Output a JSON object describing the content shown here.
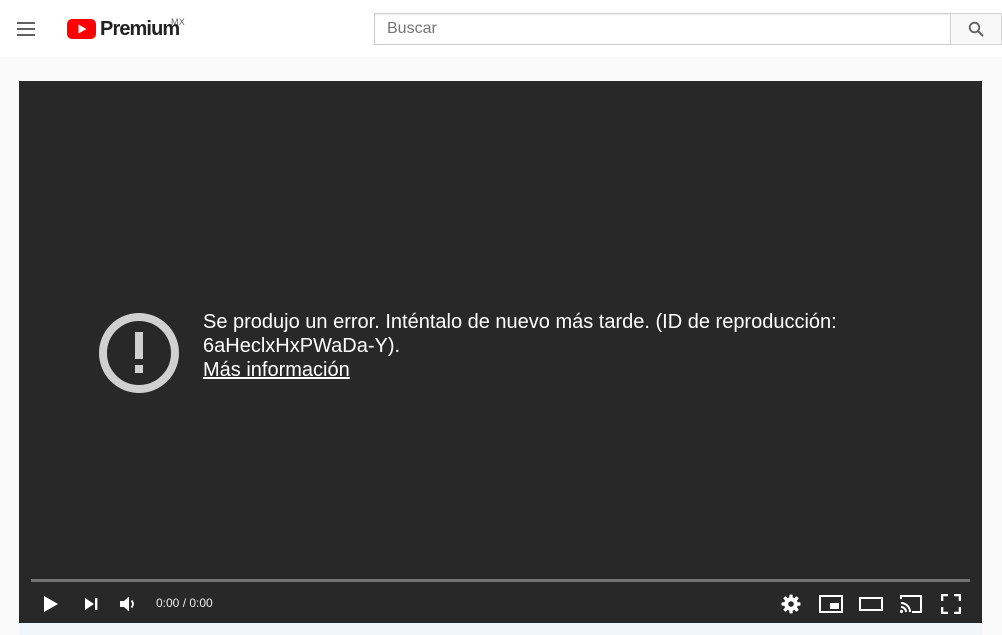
{
  "header": {
    "logo_text": "Premium",
    "logo_region": "MX",
    "search_placeholder": "Buscar"
  },
  "icons": {
    "menu": "menu-icon",
    "logo": "youtube-logo-icon",
    "search": "search-icon",
    "error": "error-exclamation-icon",
    "play": "play-icon",
    "next": "next-icon",
    "volume": "volume-icon",
    "settings": "gear-icon",
    "miniplayer": "miniplayer-icon",
    "theater": "theater-mode-icon",
    "cast": "cast-icon",
    "fullscreen": "fullscreen-icon"
  },
  "player": {
    "error_message": "Se produjo un error. Inténtalo de nuevo más tarde. (ID de reproducción: 6aHeclxHxPWaDa-Y).",
    "learn_more": "Más información",
    "time": "0:00 / 0:00"
  },
  "colors": {
    "brand_red": "#ff0000",
    "player_bg": "#282828",
    "error_icon": "#d0d0d0"
  }
}
